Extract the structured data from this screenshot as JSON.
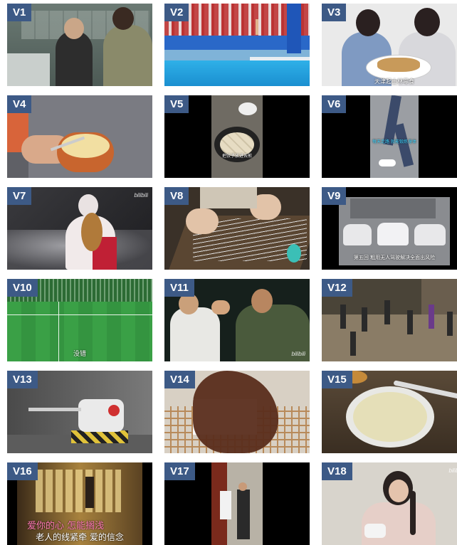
{
  "colors": {
    "tag_bg": "#3d5a86",
    "page_bg": "#ffffff"
  },
  "watermark": "bilibili",
  "tiles": [
    {
      "label": "V1",
      "scene": "pharmacy-counter-two-people"
    },
    {
      "label": "V2",
      "scene": "diving-pool-stadium"
    },
    {
      "label": "V3",
      "scene": "two-women-eating-snacks",
      "caption": "天津起士林零食"
    },
    {
      "label": "V4",
      "scene": "hand-with-pudding-cup"
    },
    {
      "label": "V5",
      "scene": "dumplings-in-pan",
      "caption": "把饺子放进去煎"
    },
    {
      "label": "V6",
      "scene": "walking-legs-vertical",
      "caption": "每天走路 就能锻炼身体"
    },
    {
      "label": "V7",
      "scene": "pipa-player-costume"
    },
    {
      "label": "V8",
      "scene": "guzheng-hands"
    },
    {
      "label": "V9",
      "scene": "self-driving-cars-row",
      "caption": "第五回 粗用无人驾驶解决全面出风险"
    },
    {
      "label": "V10",
      "scene": "football-stadium",
      "caption": "没错"
    },
    {
      "label": "V11",
      "scene": "two-men-fighting-scene"
    },
    {
      "label": "V12",
      "scene": "square-dancing-night"
    },
    {
      "label": "V13",
      "scene": "robot-turret-toy"
    },
    {
      "label": "V14",
      "scene": "chocolate-pouring-on-rack"
    },
    {
      "label": "V15",
      "scene": "soy-milk-bowl-spoon"
    },
    {
      "label": "V16",
      "scene": "karaoke-music-video",
      "caption": "爱你的心 怎能搁浅",
      "caption2": "老人的线紧牵 爱的信念"
    },
    {
      "label": "V17",
      "scene": "hallway-people-vertical"
    },
    {
      "label": "V18",
      "scene": "woman-with-braids-sewing"
    }
  ]
}
